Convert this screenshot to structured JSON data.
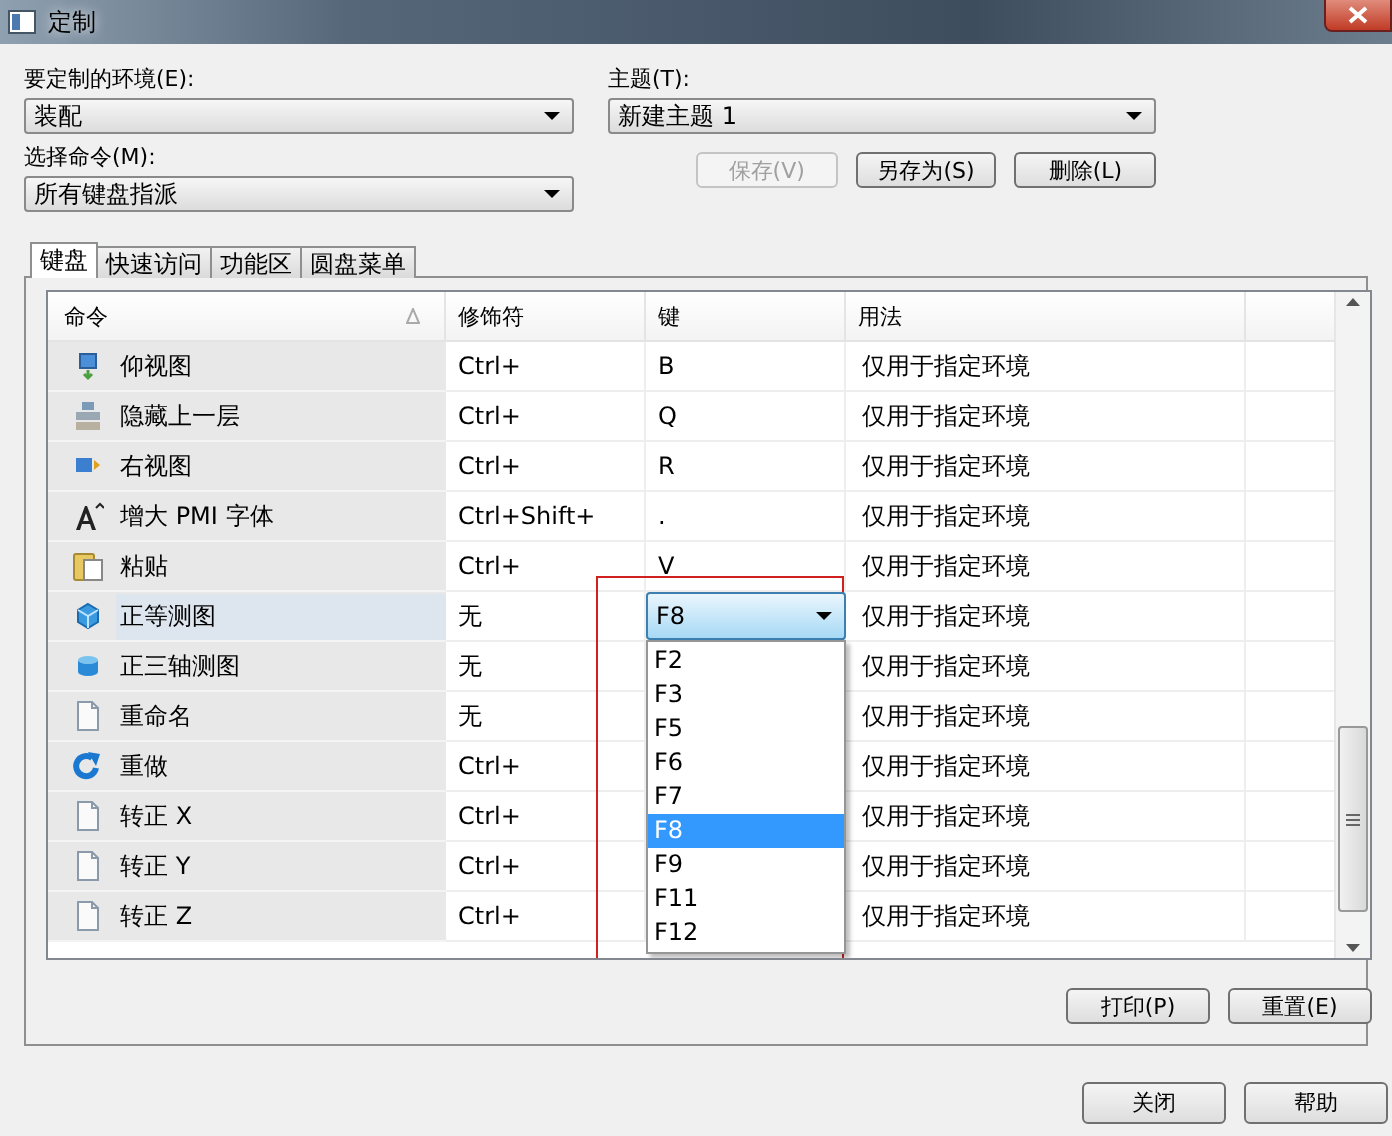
{
  "window": {
    "title": "定制"
  },
  "environment": {
    "label": "要定制的环境(E):",
    "value": "装配"
  },
  "theme": {
    "label": "主题(T):",
    "value": "新建主题 1"
  },
  "command_filter": {
    "label": "选择命令(M):",
    "value": "所有键盘指派"
  },
  "theme_buttons": [
    {
      "label": "保存(V)",
      "disabled": true
    },
    {
      "label": "另存为(S)",
      "disabled": false
    },
    {
      "label": "删除(L)",
      "disabled": false
    }
  ],
  "tabs": [
    {
      "label": "键盘",
      "selected": true
    },
    {
      "label": "快速访问",
      "selected": false
    },
    {
      "label": "功能区",
      "selected": false
    },
    {
      "label": "圆盘菜单",
      "selected": false
    }
  ],
  "table": {
    "columns": [
      "命令",
      "修饰符",
      "键",
      "用法"
    ],
    "rows": [
      {
        "kind": "monitor-down",
        "command": "仰视图",
        "modifier": "Ctrl+",
        "key": "B",
        "usage": "仅用于指定环境",
        "selected": false
      },
      {
        "kind": "layers",
        "command": "隐藏上一层",
        "modifier": "Ctrl+",
        "key": "Q",
        "usage": "仅用于指定环境",
        "selected": false
      },
      {
        "kind": "view-right",
        "command": "右视图",
        "modifier": "Ctrl+",
        "key": "R",
        "usage": "仅用于指定环境",
        "selected": false
      },
      {
        "kind": "font-up",
        "command": "增大 PMI 字体",
        "modifier": "Ctrl+Shift+",
        "key": ".",
        "usage": "仅用于指定环境",
        "selected": false
      },
      {
        "kind": "clipboard",
        "command": "粘贴",
        "modifier": "Ctrl+",
        "key": "V",
        "usage": "仅用于指定环境",
        "selected": false
      },
      {
        "kind": "cube",
        "command": "正等测图",
        "modifier": "无",
        "usage": "仅用于指定环境",
        "selected": true
      },
      {
        "kind": "cylinder",
        "command": "正三轴测图",
        "modifier": "无",
        "usage": "仅用于指定环境",
        "selected": false
      },
      {
        "kind": "document",
        "command": "重命名",
        "modifier": "无",
        "usage": "仅用于指定环境",
        "selected": false
      },
      {
        "kind": "redo",
        "command": "重做",
        "modifier": "Ctrl+",
        "usage": "仅用于指定环境",
        "selected": false
      },
      {
        "kind": "document",
        "command": "转正 X",
        "modifier": "Ctrl+",
        "usage": "仅用于指定环境",
        "selected": false
      },
      {
        "kind": "document",
        "command": "转正 Y",
        "modifier": "Ctrl+",
        "usage": "仅用于指定环境",
        "selected": false
      },
      {
        "kind": "document",
        "command": "转正 Z",
        "modifier": "Ctrl+",
        "usage": "仅用于指定环境",
        "selected": false
      }
    ]
  },
  "key_dropdown": {
    "value": "F8",
    "options": [
      {
        "label": "F2",
        "selected": false
      },
      {
        "label": "F3",
        "selected": false
      },
      {
        "label": "F5",
        "selected": false
      },
      {
        "label": "F6",
        "selected": false
      },
      {
        "label": "F7",
        "selected": false
      },
      {
        "label": "F8",
        "selected": true
      },
      {
        "label": "F9",
        "selected": false
      },
      {
        "label": "F11",
        "selected": false
      },
      {
        "label": "F12",
        "selected": false
      }
    ]
  },
  "panel_buttons": [
    "打印(P)",
    "重置(E)"
  ],
  "dialog_buttons": [
    "关闭",
    "帮助"
  ]
}
